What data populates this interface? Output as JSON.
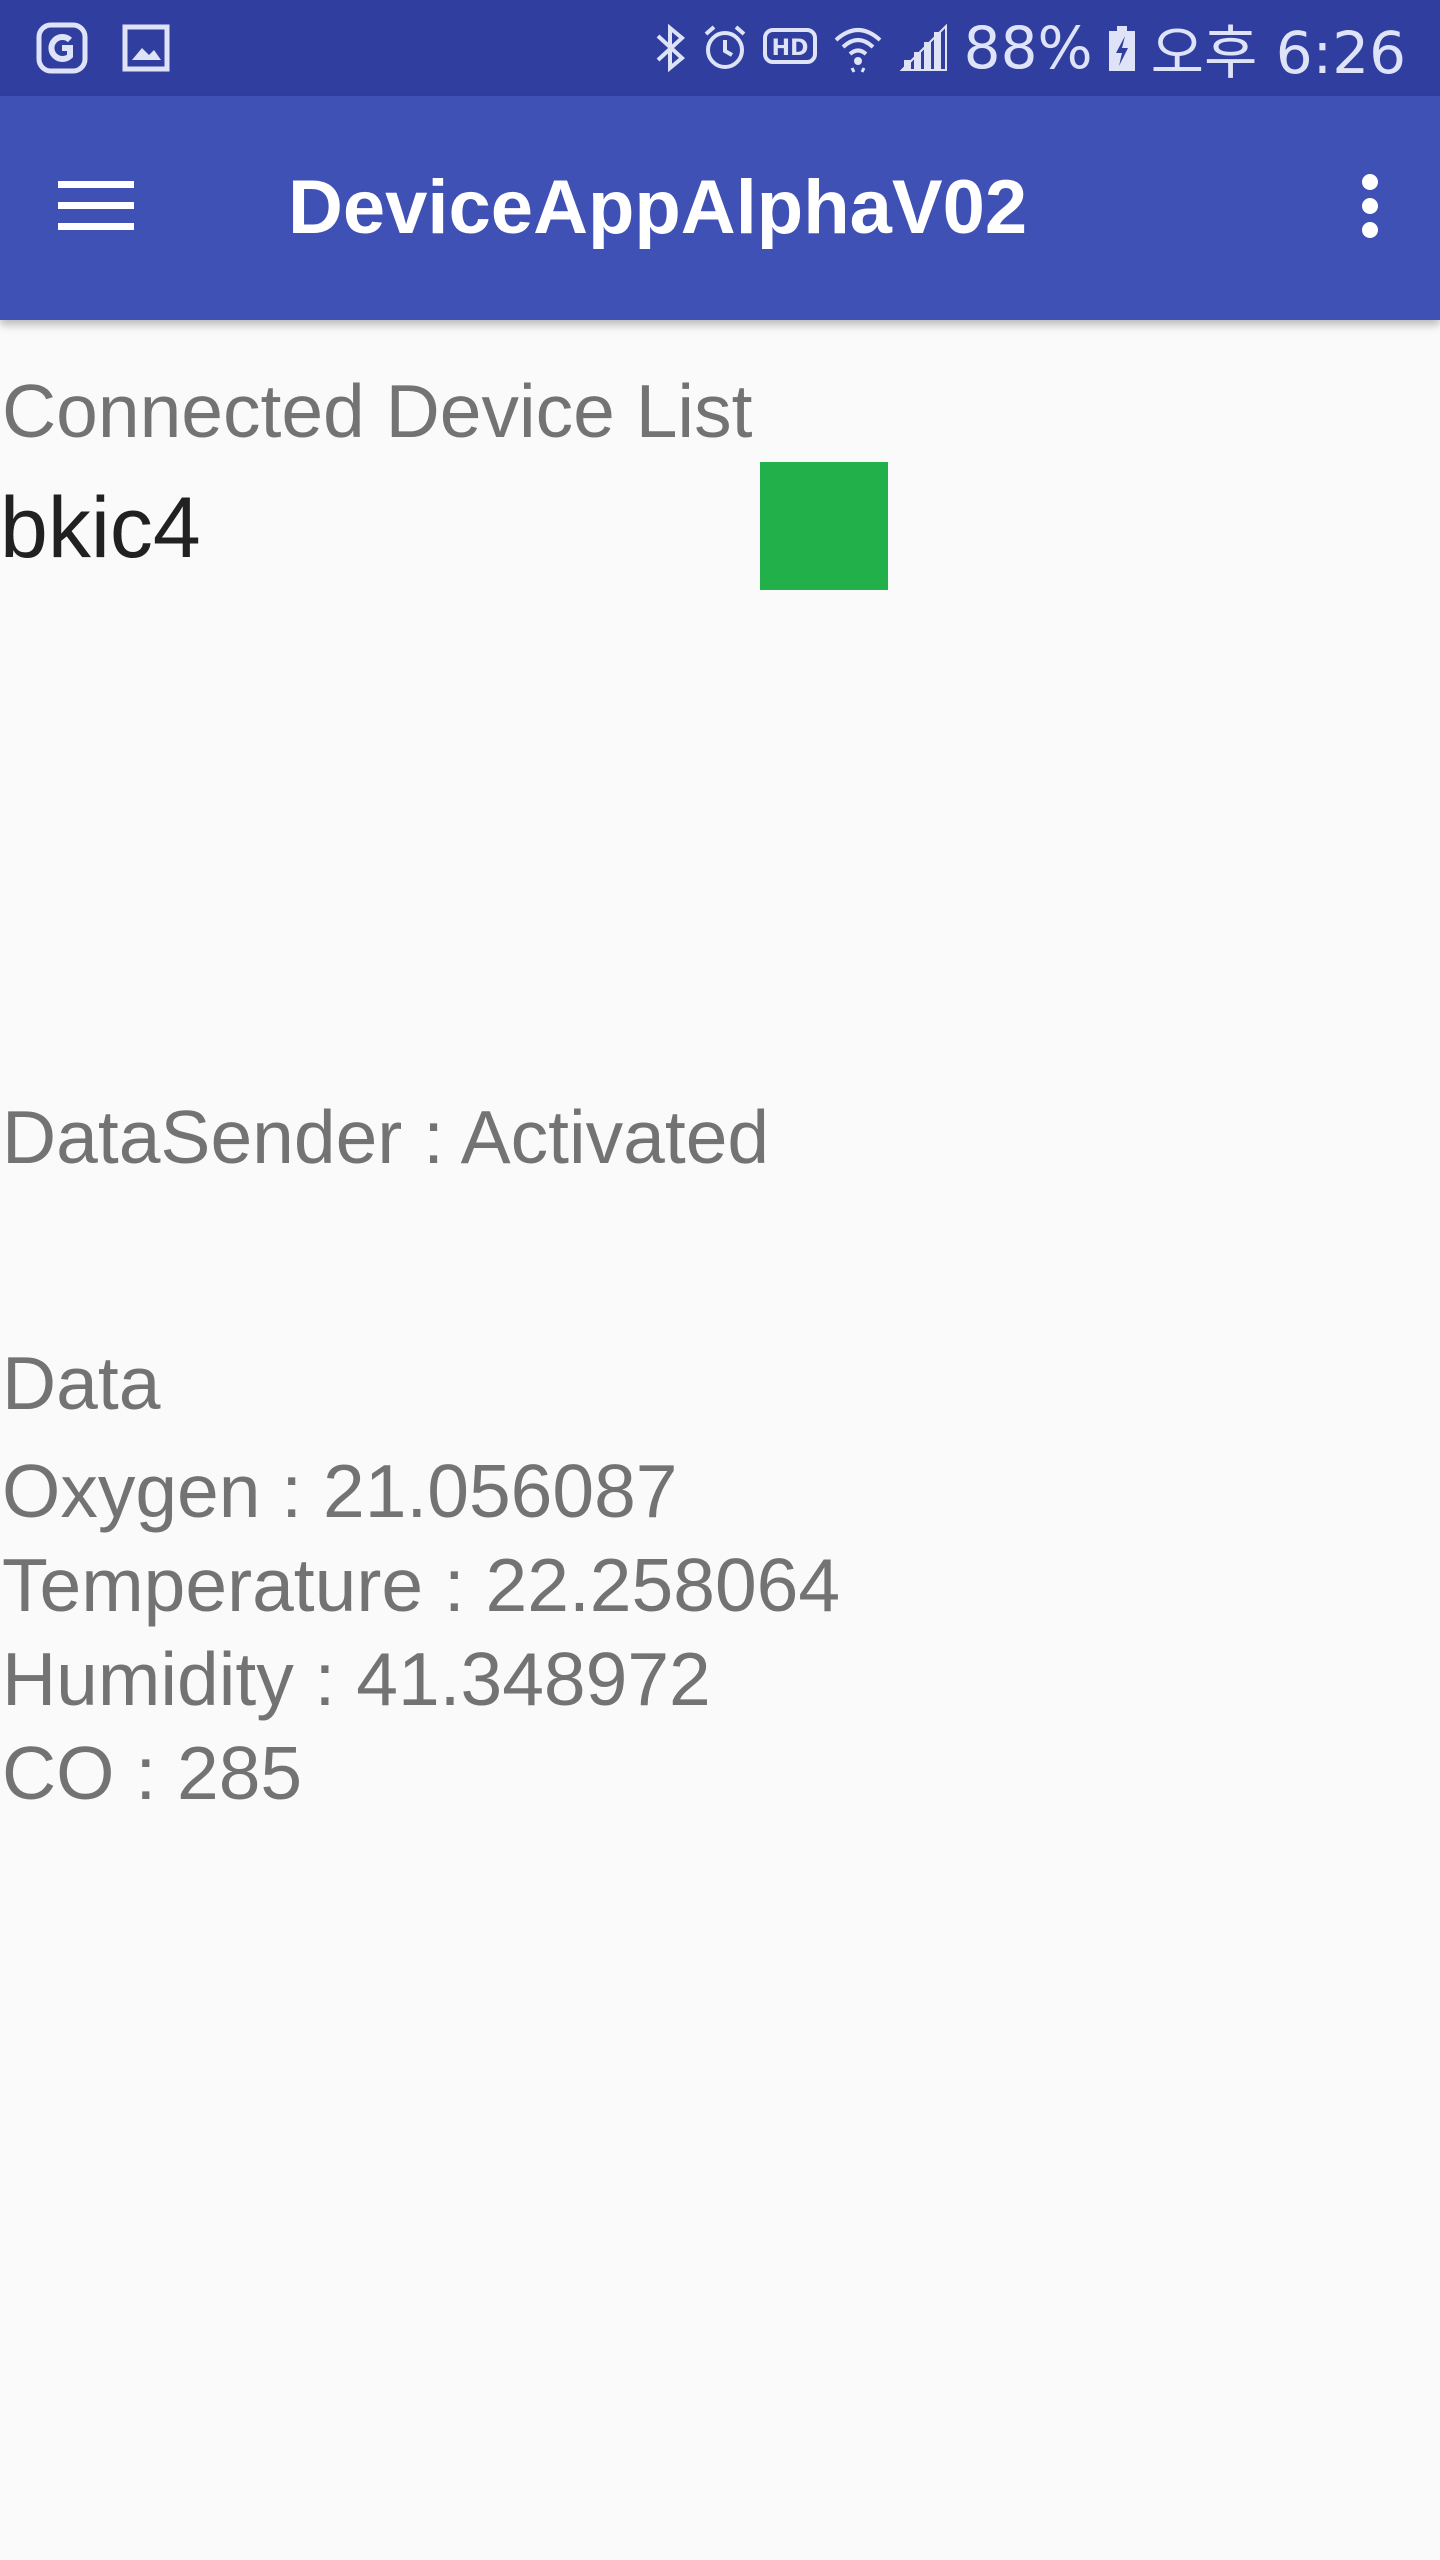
{
  "status_bar": {
    "left_icons": [
      "cloud-app-icon",
      "image-icon"
    ],
    "right_icons": [
      "bluetooth-icon",
      "alarm-icon",
      "hd-icon",
      "wifi-icon",
      "signal-icon"
    ],
    "battery_percent": "88%",
    "battery_icon": "battery-charging-icon",
    "time": "오후 6:26"
  },
  "app_bar": {
    "title": "DeviceAppAlphaV02",
    "menu_icon": "hamburger-menu-icon",
    "overflow_icon": "more-vert-icon"
  },
  "device_list": {
    "heading": "Connected Device List",
    "devices": [
      {
        "name": "bkic4",
        "status_color": "#22b04b"
      }
    ]
  },
  "data_sender": {
    "status_text": "DataSender : Activated"
  },
  "data": {
    "heading": "Data",
    "readings": [
      {
        "text": "Oxygen : 21.056087"
      },
      {
        "text": "Temperature : 22.258064"
      },
      {
        "text": "Humidity : 41.348972"
      },
      {
        "text": "CO : 285"
      }
    ]
  },
  "colors": {
    "status_bar": "#303f9f",
    "app_bar": "#3f51b5",
    "background": "#fafafa",
    "device_status": "#22b04b"
  }
}
